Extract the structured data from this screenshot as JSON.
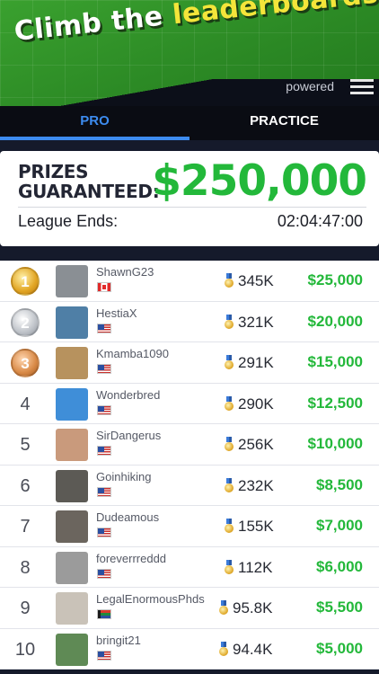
{
  "banner": {
    "headline_part1": "Climb the",
    "headline_part2": "leaderboards",
    "powered": "powered"
  },
  "tabs": [
    {
      "label": "PRO",
      "active": true
    },
    {
      "label": "PRACTICE",
      "active": false
    }
  ],
  "prize_card": {
    "prizes_line1": "PRIZES",
    "prizes_line2": "GUARANTEED:",
    "amount": "$250,000",
    "league_label": "League Ends:",
    "league_time": "02:04:47:00"
  },
  "colors": {
    "accent_blue": "#3d8cf0",
    "prize_green": "#23b83a",
    "banner_green": "#2c8a25",
    "headline_yellow": "#f4e53a"
  },
  "leaderboard": [
    {
      "rank": "1",
      "medal": "gold",
      "name": "ShawnG23",
      "flag": "ca",
      "score": "345K",
      "prize": "$25,000",
      "avatar_color": "#8a8f94"
    },
    {
      "rank": "2",
      "medal": "silver",
      "name": "HestiaX",
      "flag": "us",
      "score": "321K",
      "prize": "$20,000",
      "avatar_color": "#4f7fa6"
    },
    {
      "rank": "3",
      "medal": "bronze",
      "name": "Kmamba1090",
      "flag": "us",
      "score": "291K",
      "prize": "$15,000",
      "avatar_color": "#b7925e"
    },
    {
      "rank": "4",
      "medal": "",
      "name": "Wonderbred",
      "flag": "us",
      "score": "290K",
      "prize": "$12,500",
      "avatar_color": "#3f8ed8"
    },
    {
      "rank": "5",
      "medal": "",
      "name": "SirDangerus",
      "flag": "us",
      "score": "256K",
      "prize": "$10,000",
      "avatar_color": "#c99a7c"
    },
    {
      "rank": "6",
      "medal": "",
      "name": "Goinhiking",
      "flag": "us",
      "score": "232K",
      "prize": "$8,500",
      "avatar_color": "#5c5a55"
    },
    {
      "rank": "7",
      "medal": "",
      "name": "Dudeamous",
      "flag": "us",
      "score": "155K",
      "prize": "$7,000",
      "avatar_color": "#6b655e"
    },
    {
      "rank": "8",
      "medal": "",
      "name": "foreverrreddd",
      "flag": "us",
      "score": "112K",
      "prize": "$6,000",
      "avatar_color": "#9b9b9b"
    },
    {
      "rank": "9",
      "medal": "",
      "name": "LegalEnormousPhds",
      "flag": "za",
      "score": "95.8K",
      "prize": "$5,500",
      "avatar_color": "#c9c2b8"
    },
    {
      "rank": "10",
      "medal": "",
      "name": "bringit21",
      "flag": "us",
      "score": "94.4K",
      "prize": "$5,000",
      "avatar_color": "#5f8a55"
    }
  ]
}
